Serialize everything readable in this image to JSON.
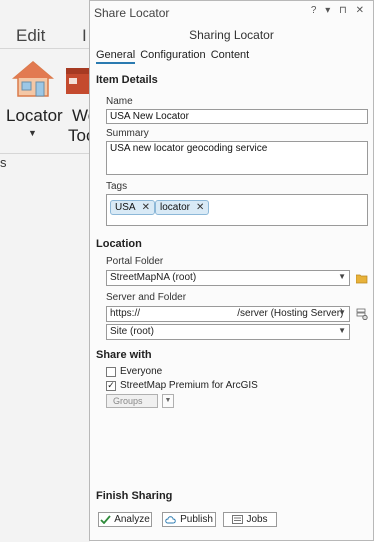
{
  "ribbon": {
    "tab_edit": "Edit",
    "tab_partial": "I",
    "locator_label": "Locator",
    "partial_top": "We",
    "partial_bottom": "Too",
    "group_partial": "s"
  },
  "pane": {
    "title": "Share Locator",
    "controls": "? ▾ ⊓ ✕",
    "header": "Sharing Locator",
    "tabs": [
      "General",
      "Configuration",
      "Content"
    ],
    "item_details": {
      "heading": "Item Details",
      "name_label": "Name",
      "name_value": "USA New Locator",
      "summary_label": "Summary",
      "summary_value": "USA new locator geocoding service",
      "tags_label": "Tags",
      "tags": [
        "USA",
        "locator"
      ]
    },
    "location": {
      "heading": "Location",
      "portal_label": "Portal Folder",
      "portal_value": "StreetMapNA (root)",
      "server_label": "Server and Folder",
      "server_value": "https://                                   /server (Hosting Server)",
      "site_value": "Site (root)"
    },
    "share_with": {
      "heading": "Share with",
      "everyone": "Everyone",
      "premium": "StreetMap Premium for ArcGIS",
      "groups": "Groups"
    },
    "finish": {
      "heading": "Finish Sharing",
      "analyze": "Analyze",
      "publish": "Publish",
      "jobs": "Jobs"
    }
  },
  "colors": {
    "accent": "#2a7ab0",
    "chip_bg": "#d9eaf6",
    "folder": "#e8b23a"
  }
}
